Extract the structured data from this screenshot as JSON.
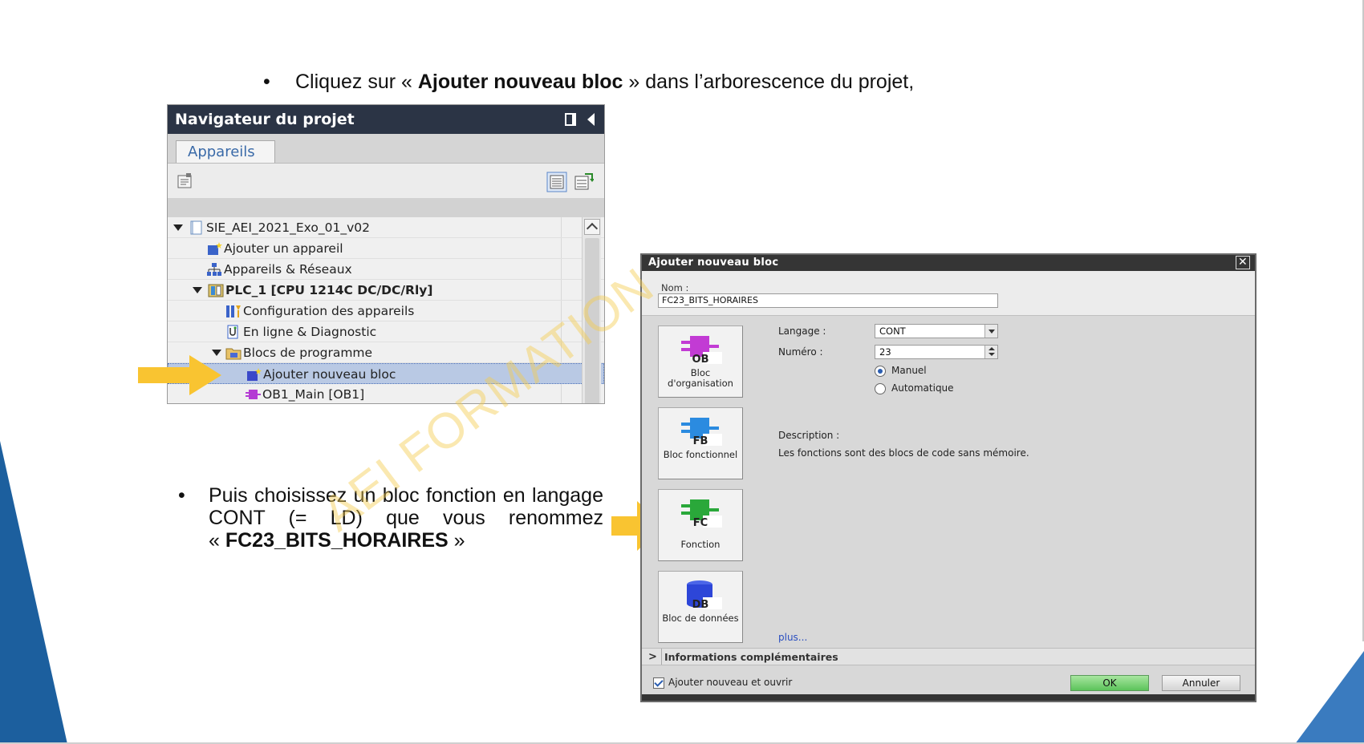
{
  "instructions": {
    "bullet": "•",
    "step1_before": "Cliquez sur « ",
    "step1_bold": "Ajouter nouveau bloc",
    "step1_after": " » dans l’arborescence du projet,",
    "step2_line1": "Puis choisissez un bloc fonction en langage CONT (= LD) que vous renommez",
    "step2_prefix": "« ",
    "step2_bold": "FC23_BITS_HORAIRES",
    "step2_suffix": " »"
  },
  "watermark": "AEI FORMATION",
  "navigator": {
    "title": "Navigateur du projet",
    "tab": "Appareils",
    "tree": [
      {
        "label": "SIE_AEI_2021_Exo_01_v02",
        "icon": "project-icon"
      },
      {
        "label": "Ajouter un appareil",
        "icon": "add-device-icon"
      },
      {
        "label": "Appareils & Réseaux",
        "icon": "network-icon"
      },
      {
        "label": "PLC_1 [CPU 1214C DC/DC/Rly]",
        "icon": "plc-icon"
      },
      {
        "label": "Configuration des appareils",
        "icon": "device-config-icon"
      },
      {
        "label": "En ligne & Diagnostic",
        "icon": "diagnostic-icon"
      },
      {
        "label": "Blocs de programme",
        "icon": "folder-icon"
      },
      {
        "label": "Ajouter nouveau bloc",
        "icon": "add-block-icon"
      },
      {
        "label": "OB1_Main [OB1]",
        "icon": "ob-block-icon"
      }
    ]
  },
  "dialog": {
    "title": "Ajouter nouveau bloc",
    "close": "✕",
    "name_label": "Nom :",
    "name_value": "FC23_BITS_HORAIRES",
    "blocks": [
      {
        "badge": "OB",
        "label": "Bloc d'organisation",
        "color": "#c23bd4"
      },
      {
        "badge": "FB",
        "label": "Bloc fonctionnel",
        "color": "#2b8be0"
      },
      {
        "badge": "FC",
        "label": "Fonction",
        "color": "#2aa83a"
      },
      {
        "badge": "DB",
        "label": "Bloc de données",
        "color": "#2d46d8"
      }
    ],
    "language_label": "Langage :",
    "language_value": "CONT",
    "number_label": "Numéro :",
    "number_value": "23",
    "radio_manual": "Manuel",
    "radio_auto": "Automatique",
    "description_label": "Description :",
    "description_text": "Les fonctions sont des blocs de code sans mémoire.",
    "more_link": "plus...",
    "info_chevron": ">",
    "info_label": "Informations complémentaires",
    "open_checkbox_label": "Ajouter nouveau et ouvrir",
    "ok_label": "OK",
    "cancel_label": "Annuler"
  },
  "colors": {
    "accent_blue": "#1f5fa0",
    "arrow_yellow": "#f9c431",
    "title_dark": "#2b3445"
  }
}
